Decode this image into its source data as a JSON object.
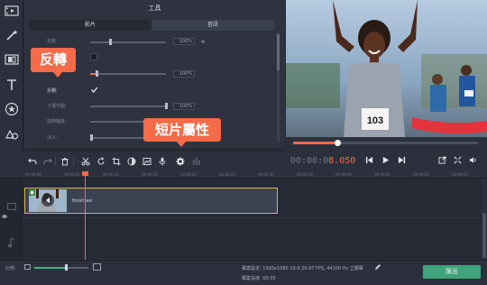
{
  "tools_panel": {
    "title": "工具",
    "tabs": [
      {
        "label": "影片",
        "active": true
      },
      {
        "label": "音訊",
        "active": false
      }
    ],
    "properties": [
      {
        "label": "音量",
        "value": "100%"
      },
      {
        "label": "",
        "value": ""
      },
      {
        "label": "",
        "value": "100%"
      },
      {
        "label": "反轉:",
        "checked": true
      },
      {
        "label": "下選作圖:",
        "value": "100%"
      },
      {
        "label": "旋轉軸度:",
        "value": ""
      },
      {
        "label": "淡入:",
        "value": ""
      }
    ]
  },
  "callouts": {
    "reverse": "反轉",
    "clip_properties": "短片屬性"
  },
  "player": {
    "progress": 0.24,
    "timecode_dim": "00:00:0",
    "timecode_hot": "8.050",
    "bib_number": "103"
  },
  "timeline": {
    "ruler_ticks": [
      "00:00:00",
      "00:00:05",
      "00:00:10",
      "00:00:15",
      "00:00:20",
      "00:00:25",
      "00:00:30",
      "00:00:35",
      "00:00:40",
      "00:00:45",
      "00:00:50",
      "00:00:55"
    ],
    "clip_name": "finish.avi"
  },
  "bottom": {
    "zoom_label": "比例:",
    "zoom_level": 0.58,
    "project_settings": "專案設定:  1920x1080 16:9 29.97 FPS, 44100 Hz 立體聲",
    "project_length": "專案長度:  00:35",
    "export_label": "匯出"
  },
  "colors": {
    "accent": "#f36b49",
    "export": "#3fa37b",
    "clip_border": "#d6b64a"
  }
}
